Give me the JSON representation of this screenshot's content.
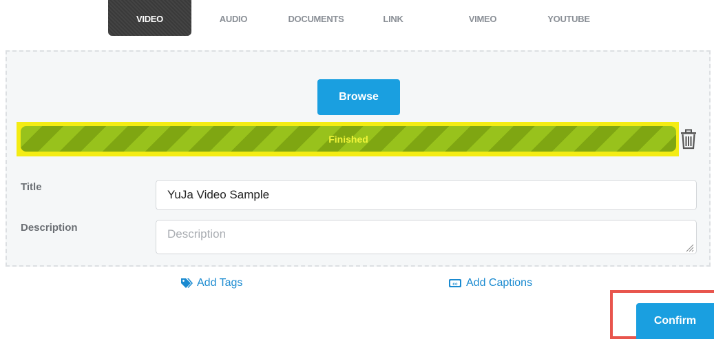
{
  "tabs": [
    {
      "label": "VIDEO",
      "active": true
    },
    {
      "label": "AUDIO",
      "active": false
    },
    {
      "label": "DOCUMENTS",
      "active": false
    },
    {
      "label": "LINK",
      "active": false
    },
    {
      "label": "VIMEO",
      "active": false
    },
    {
      "label": "YOUTUBE",
      "active": false
    }
  ],
  "upload": {
    "browse_label": "Browse",
    "progress": {
      "status_text": "Finished",
      "percent": 100,
      "color": "#8fba18",
      "highlight_color": "#f4ec14"
    },
    "delete_icon": "trash-icon"
  },
  "form": {
    "title_label": "Title",
    "title_value": "YuJa Video Sample",
    "description_label": "Description",
    "description_placeholder": "Description",
    "description_value": ""
  },
  "actions": {
    "add_tags": {
      "label": "Add Tags",
      "icon": "tags-icon"
    },
    "add_captions": {
      "label": "Add Captions",
      "icon": "closed-captions-icon"
    },
    "confirm_label": "Confirm",
    "confirm_highlight_color": "#e8554d"
  },
  "colors": {
    "accent": "#1a9fe0",
    "link": "#1a8ad0",
    "active_tab": "#3e3e3e"
  }
}
